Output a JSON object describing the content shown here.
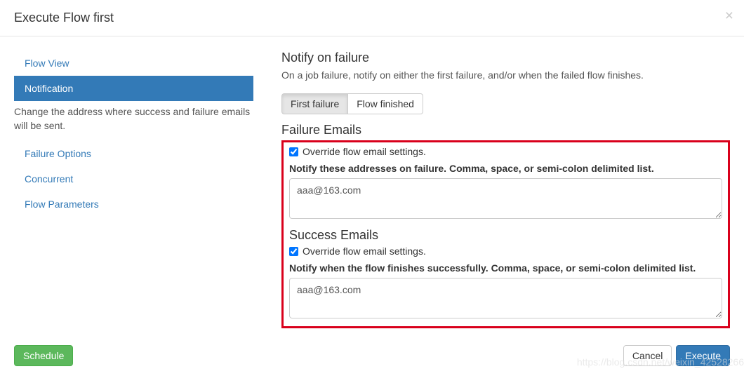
{
  "header": {
    "title": "Execute Flow first",
    "close": "×"
  },
  "sidebar": {
    "items": [
      {
        "label": "Flow View"
      },
      {
        "label": "Notification"
      },
      {
        "label": "Failure Options"
      },
      {
        "label": "Concurrent"
      },
      {
        "label": "Flow Parameters"
      }
    ],
    "active_desc": "Change the address where success and failure emails will be sent."
  },
  "content": {
    "section_title": "Notify on failure",
    "section_desc": "On a job failure, notify on either the first failure, and/or when the failed flow finishes.",
    "toggle": {
      "first": "First failure",
      "finished": "Flow finished"
    },
    "failure": {
      "title": "Failure Emails",
      "override_label": "Override flow email settings.",
      "override_checked": true,
      "field_label": "Notify these addresses on failure. Comma, space, or semi-colon delimited list.",
      "value": "aaa@163.com"
    },
    "success": {
      "title": "Success Emails",
      "override_label": "Override flow email settings.",
      "override_checked": true,
      "field_label": "Notify when the flow finishes successfully. Comma, space, or semi-colon delimited list.",
      "value": "aaa@163.com"
    }
  },
  "footer": {
    "schedule": "Schedule",
    "cancel": "Cancel",
    "execute": "Execute"
  },
  "watermark": "https://blog.csdn.net/weixin_42528266"
}
